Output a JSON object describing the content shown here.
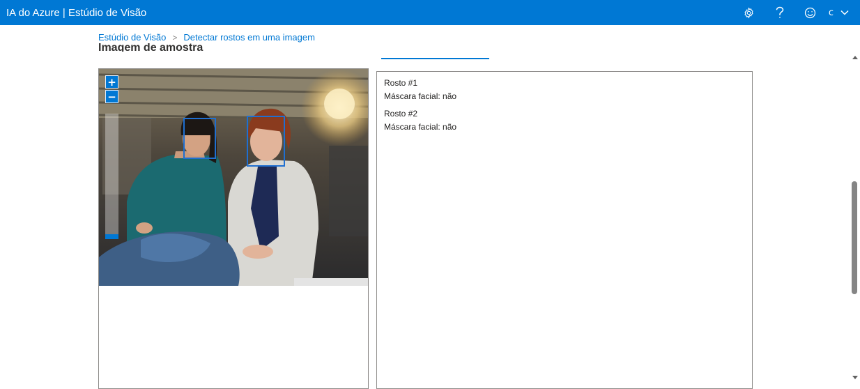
{
  "app": {
    "title": "IA do Azure | Estúdio de Visão"
  },
  "header": {
    "icons": [
      "gear-icon",
      "help-icon",
      "smiley-icon",
      "chevron-down-icon"
    ],
    "user_initial": "c"
  },
  "breadcrumb": {
    "root": "Estúdio de Visão",
    "separator": ">",
    "current": "Detectar rostos em uma imagem"
  },
  "section": {
    "title": "Imagem de amostra"
  },
  "image_viewer": {
    "zoom_in_label": "+",
    "zoom_out_label": "−"
  },
  "results": {
    "faces": [
      {
        "label": "Rosto #1",
        "mask": "Máscara facial: não"
      },
      {
        "label": "Rosto #2",
        "mask": "Máscara facial: não"
      }
    ]
  },
  "colors": {
    "accent": "#0078d4",
    "header_bg": "#0078d4",
    "face_box": "#1f6fd1"
  }
}
